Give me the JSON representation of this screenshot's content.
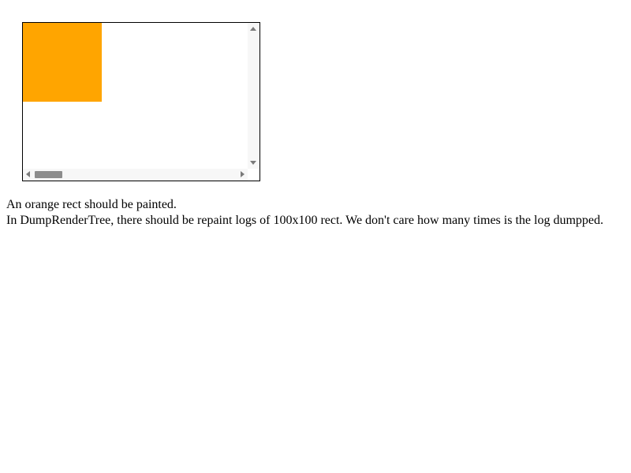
{
  "scroll_container": {
    "rect_color": "#ffa500",
    "horizontal_scrollbar": {
      "left_arrow_icon": "arrow-left-icon",
      "right_arrow_icon": "arrow-right-icon"
    },
    "vertical_scrollbar": {
      "up_arrow_icon": "arrow-up-icon",
      "down_arrow_icon": "arrow-down-icon"
    }
  },
  "description": {
    "line1": "An orange rect should be painted.",
    "line2": "In DumpRenderTree, there should be repaint logs of 100x100 rect. We don't care how many times is the log dumpped."
  }
}
